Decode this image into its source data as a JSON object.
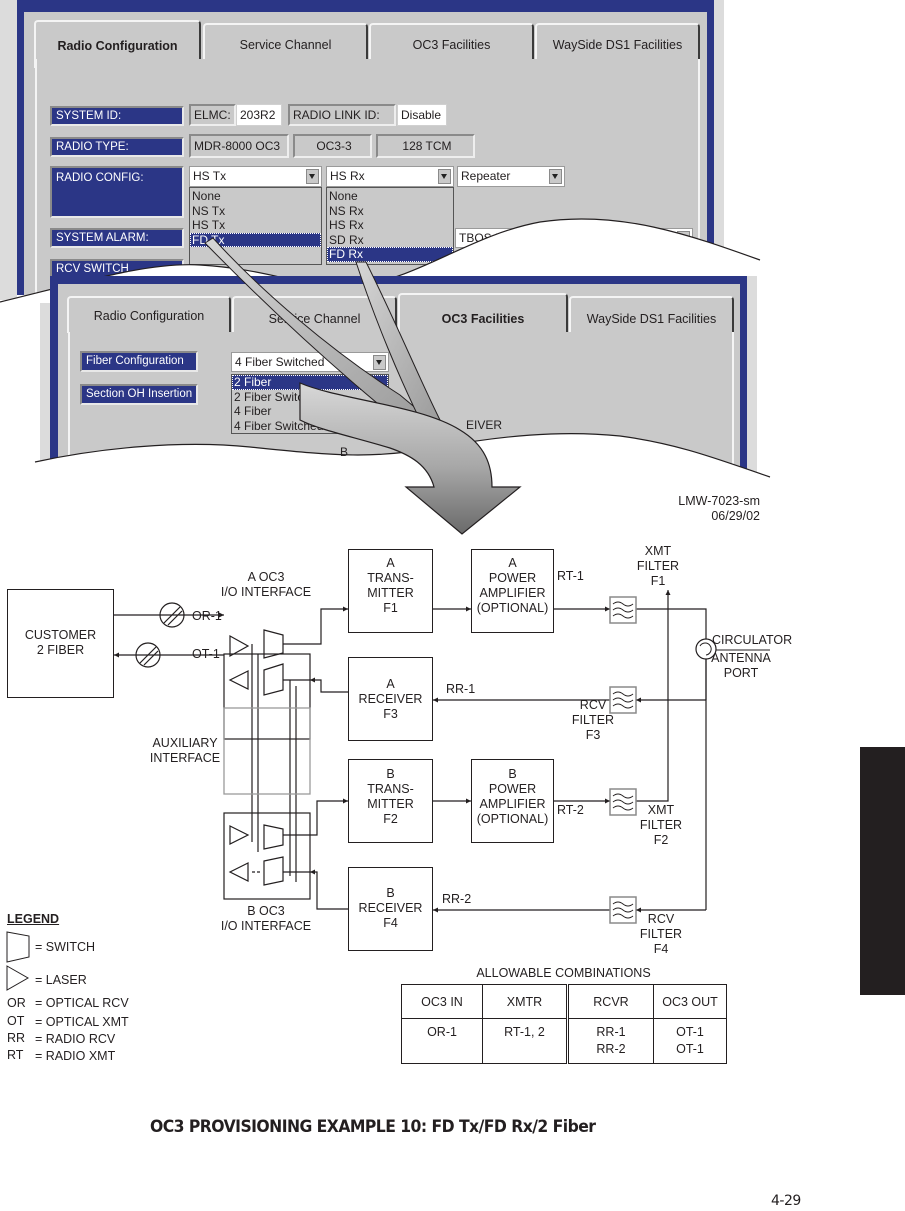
{
  "screen1": {
    "tabs": [
      {
        "label": "Radio Configuration",
        "active": true
      },
      {
        "label": "Service Channel",
        "active": false
      },
      {
        "label": "OC3 Facilities",
        "active": false
      },
      {
        "label": "WaySide DS1 Facilities",
        "active": false
      }
    ],
    "rows": {
      "system_id": {
        "label": "SYSTEM ID:",
        "elmc_label": "ELMC:",
        "elmc_value": "203R2",
        "radio_link_label": "RADIO LINK ID:",
        "radio_link_value": "Disable"
      },
      "radio_type": {
        "label": "RADIO TYPE:",
        "values": [
          "MDR-8000 OC3",
          "OC3-3",
          "128 TCM"
        ]
      },
      "radio_config": {
        "label": "RADIO CONFIG:",
        "tx_select": "HS Tx",
        "tx_options": [
          "None",
          "NS Tx",
          "HS Tx",
          "FD Tx"
        ],
        "tx_selected": "FD Tx",
        "rx_select": "HS Rx",
        "rx_options": [
          "None",
          "NS Rx",
          "HS Rx",
          "SD Rx",
          "FD Rx"
        ],
        "rx_selected": "FD Rx",
        "repeater_select": "Repeater"
      },
      "system_alarm": {
        "label": "SYSTEM ALARM:",
        "value_partial": "TBOS Dis"
      },
      "rcv_switch": {
        "label": "RCV SWITCH"
      }
    }
  },
  "screen2": {
    "tabs": [
      {
        "label": "Radio Configuration",
        "active": false
      },
      {
        "label": "Service Channel",
        "active": false
      },
      {
        "label": "OC3 Facilities",
        "active": true
      },
      {
        "label": "WaySide DS1 Facilities",
        "active": false
      }
    ],
    "fiber_config": {
      "label": "Fiber Configuration",
      "select": "4 Fiber Switched",
      "options": [
        "2 Fiber",
        "2 Fiber Switched",
        "4 Fiber",
        "4 Fiber Switched"
      ],
      "selected": "2 Fiber"
    },
    "section_oh": {
      "label": "Section OH Insertion"
    },
    "partial_text_receiver": "EIVER",
    "partial_text_b": "B"
  },
  "drawing_id": {
    "code": "LMW-7023-sm",
    "date": "06/29/02"
  },
  "diagram": {
    "customer": "CUSTOMER\n2 FIBER",
    "a_oc3": "A OC3\nI/O INTERFACE",
    "b_oc3": "B OC3\nI/O INTERFACE",
    "aux": "AUXILIARY\nINTERFACE",
    "or1": "OR-1",
    "ot1": "OT-1",
    "a_tx": "A\nTRANS-\nMITTER\nF1",
    "a_rx": "A\nRECEIVER\nF3",
    "b_tx": "B\nTRANS-\nMITTER\nF2",
    "b_rx": "B\nRECEIVER\nF4",
    "a_pa": "A\nPOWER\nAMPLIFIER\n(OPTIONAL)",
    "b_pa": "B\nPOWER\nAMPLIFIER\n(OPTIONAL)",
    "rt1": "RT-1",
    "rt2": "RT-2",
    "rr1": "RR-1",
    "rr2": "RR-2",
    "xmt_f1": "XMT\nFILTER\nF1",
    "rcv_f3": "RCV\nFILTER\nF3",
    "xmt_f2": "XMT\nFILTER\nF2",
    "rcv_f4": "RCV\nFILTER\nF4",
    "circulator": "CIRCULATOR",
    "antenna": "ANTENNA\nPORT"
  },
  "legend": {
    "title": "LEGEND",
    "items": [
      {
        "symbol": "switch",
        "text": "= SWITCH"
      },
      {
        "symbol": "laser",
        "text": "= LASER"
      },
      {
        "abbr": "OR",
        "text": "= OPTICAL RCV"
      },
      {
        "abbr": "OT",
        "text": "= OPTICAL XMT"
      },
      {
        "abbr": "RR",
        "text": "= RADIO RCV"
      },
      {
        "abbr": "RT",
        "text": "= RADIO XMT"
      }
    ]
  },
  "combinations": {
    "title": "ALLOWABLE COMBINATIONS",
    "headers": [
      "OC3 IN",
      "XMTR",
      "RCVR",
      "OC3 OUT"
    ],
    "rows": [
      [
        "OR-1",
        "RT-1, 2",
        "RR-1",
        "OT-1"
      ],
      [
        "",
        "",
        "RR-2",
        "OT-1"
      ]
    ]
  },
  "caption": "OC3 PROVISIONING EXAMPLE 10:  FD Tx/FD Rx/2 Fiber",
  "page_number": "4-29",
  "colors": {
    "gui_blue": "#2b3686",
    "gui_gray": "#c9c9c9",
    "ink": "#231f20",
    "thumb_tab": "#231f20"
  }
}
